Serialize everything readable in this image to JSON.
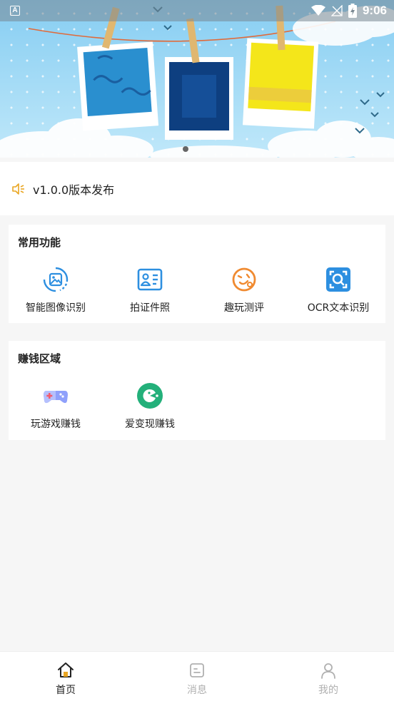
{
  "status_bar": {
    "time": "9:06",
    "left_badge": "A",
    "icons": [
      "wifi-icon",
      "signal-icon",
      "battery-icon"
    ]
  },
  "banner": {
    "page_count": 3,
    "active_page": 1
  },
  "notice": {
    "icon": "speaker-icon",
    "text": "v1.0.0版本发布"
  },
  "common_section": {
    "title": "常用功能",
    "items": [
      {
        "label": "智能图像识别",
        "icon": "image-recognition-icon",
        "color": "#2d8fe0"
      },
      {
        "label": "拍证件照",
        "icon": "id-card-icon",
        "color": "#2d8fe0"
      },
      {
        "label": "趣玩测评",
        "icon": "face-icon",
        "color": "#f08a30"
      },
      {
        "label": "OCR文本识别",
        "icon": "ocr-scan-icon",
        "color": "#2d8fe0"
      }
    ]
  },
  "earn_section": {
    "title": "赚钱区域",
    "items": [
      {
        "label": "玩游戏赚钱",
        "icon": "gamepad-icon",
        "color": "#6b7cf6"
      },
      {
        "label": "爱变现赚钱",
        "icon": "pacman-icon",
        "color": "#23b07a"
      }
    ]
  },
  "bottom_nav": {
    "items": [
      {
        "label": "首页",
        "icon": "home-icon",
        "active": true
      },
      {
        "label": "消息",
        "icon": "message-icon",
        "active": false
      },
      {
        "label": "我的",
        "icon": "profile-icon",
        "active": false
      }
    ]
  },
  "colors": {
    "accent_gold": "#e9a623",
    "blue": "#2d8fe0",
    "orange": "#f08a30",
    "green": "#23b07a",
    "inactive_gray": "#b0b0b0"
  }
}
